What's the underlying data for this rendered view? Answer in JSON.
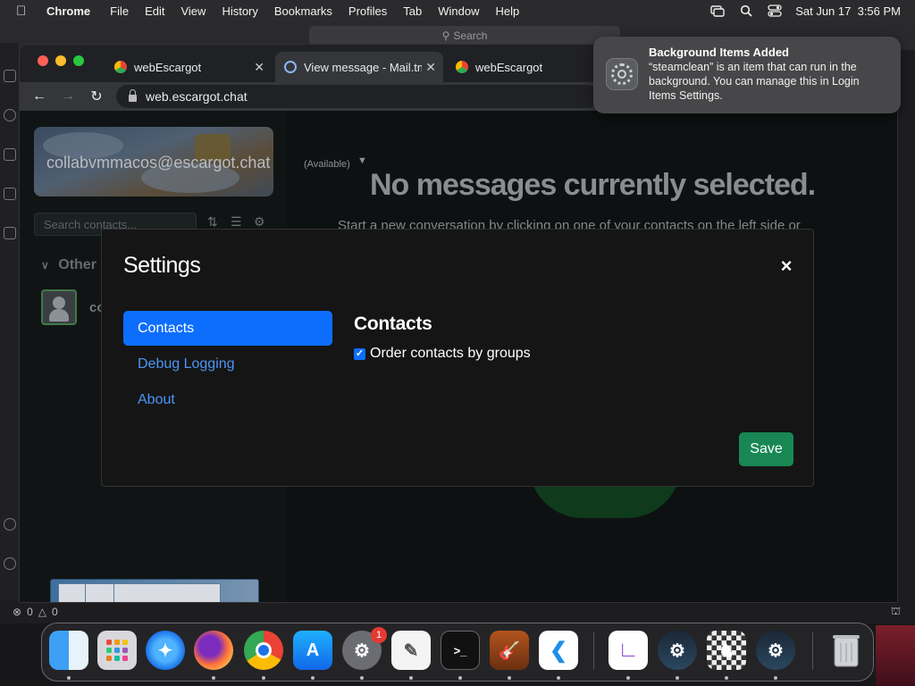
{
  "menubar": {
    "app_name": "Chrome",
    "items": [
      "File",
      "Edit",
      "View",
      "History",
      "Bookmarks",
      "Profiles",
      "Tab",
      "Window",
      "Help"
    ],
    "datetime": "Sat Jun 17  3:56 PM",
    "icons": [
      "screen-mirroring-icon",
      "search-icon",
      "control-center-icon"
    ]
  },
  "ide": {
    "search_placeholder": "Search",
    "status_errors": "0",
    "status_warnings": "0"
  },
  "chrome": {
    "tabs": [
      {
        "title": "webEscargot",
        "active": false
      },
      {
        "title": "View message - Mail.tm",
        "active": true
      },
      {
        "title": "webEscargot",
        "active": false
      }
    ],
    "url": "web.escargot.chat"
  },
  "escargot": {
    "profile_email": "collabvmmacos@escargot.chat",
    "profile_status": "(Available)",
    "search_placeholder": "Search contacts...",
    "group_header": "Other",
    "contact_name": "co",
    "no_messages_title": "No messages currently selected.",
    "no_messages_sub": "Start a new conversation by clicking on one of your contacts on the left side or"
  },
  "notification": {
    "title": "Background Items Added",
    "body": "“steamclean” is an item that can run in the background. You can manage this in Login Items Settings."
  },
  "settings_modal": {
    "title": "Settings",
    "close_label": "×",
    "nav": [
      {
        "label": "Contacts",
        "active": true
      },
      {
        "label": "Debug Logging",
        "active": false
      },
      {
        "label": "About",
        "active": false
      }
    ],
    "section_heading": "Contacts",
    "order_contacts_label": "Order contacts by groups",
    "order_contacts_checked": true,
    "save_label": "Save"
  },
  "dock": {
    "apps": [
      "Finder",
      "Launchpad",
      "Safari",
      "Firefox",
      "Chrome",
      "App Store",
      "System Settings",
      "TextEdit",
      "Terminal",
      "GarageBand",
      "Visual Studio Code",
      "Visual Studio",
      "Steam",
      "Chess",
      "Steam",
      "Trash"
    ],
    "settings_badge": "1"
  },
  "colors": {
    "accent_blue": "#0d6efd",
    "save_green": "#198754",
    "link_blue": "#4c96f7"
  }
}
